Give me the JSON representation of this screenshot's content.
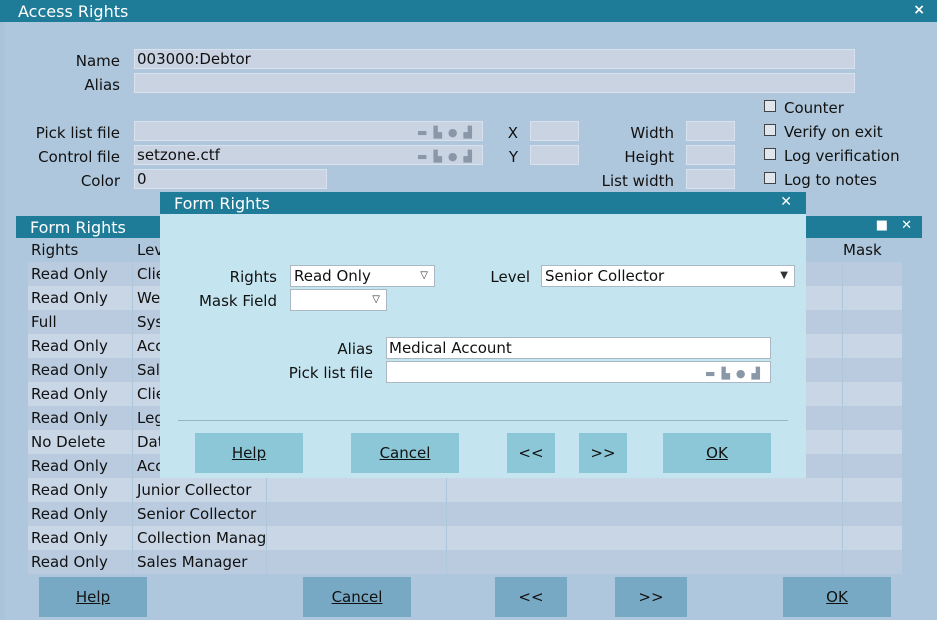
{
  "window": {
    "title": "Access Rights",
    "close": "×"
  },
  "fields": {
    "name_label": "Name",
    "name_value": "003000:Debtor",
    "alias_label": "Alias",
    "alias_value": "",
    "picklist_label": "Pick list file",
    "picklist_value": "",
    "control_label": "Control file",
    "control_value": "setzone.ctf",
    "color_label": "Color",
    "color_value": "0",
    "x_label": "X",
    "x_value": "",
    "y_label": "Y",
    "y_value": "",
    "width_label": "Width",
    "width_value": "",
    "height_label": "Height",
    "height_value": "",
    "listwidth_label": "List width",
    "listwidth_value": ""
  },
  "checkboxes": [
    {
      "label": "Counter",
      "checked": false
    },
    {
      "label": "Verify on exit",
      "checked": false
    },
    {
      "label": "Log verification",
      "checked": false
    },
    {
      "label": "Log to notes",
      "checked": false
    }
  ],
  "tool_icons": [
    "folder-icon",
    "print-icon",
    "clear-icon",
    "search-icon"
  ],
  "form_rights": {
    "title": "Form Rights",
    "headers": [
      "Rights",
      "Lev",
      "",
      "",
      "Mask Fie"
    ],
    "rows": [
      [
        "Read Only",
        "Clie"
      ],
      [
        "Read Only",
        "We"
      ],
      [
        "Full",
        "Sys"
      ],
      [
        "Read Only",
        "Acc"
      ],
      [
        "Read Only",
        "Sal"
      ],
      [
        "Read Only",
        "Clie"
      ],
      [
        "Read Only",
        "Leg"
      ],
      [
        "No Delete",
        "Dat"
      ],
      [
        "Read Only",
        "Acc"
      ],
      [
        "Read Only",
        "Junior Collector"
      ],
      [
        "Read Only",
        "Senior Collector"
      ],
      [
        "Read Only",
        "Collection Manage"
      ],
      [
        "Read Only",
        "Sales Manager"
      ]
    ]
  },
  "bottom_buttons": {
    "help": "Help",
    "cancel": "Cancel",
    "prev": "<<",
    "next": ">>",
    "ok": "OK"
  },
  "dialog": {
    "title": "Form Rights",
    "rights_label": "Rights",
    "rights_value": "Read Only",
    "level_label": "Level",
    "level_value": "Senior Collector",
    "mask_label": "Mask Field",
    "mask_value": "",
    "alias_label": "Alias",
    "alias_value": "Medical Account",
    "picklist_label": "Pick list file",
    "picklist_value": "",
    "buttons": {
      "help": "Help",
      "cancel": "Cancel",
      "prev": "<<",
      "next": ">>",
      "ok": "OK"
    }
  }
}
